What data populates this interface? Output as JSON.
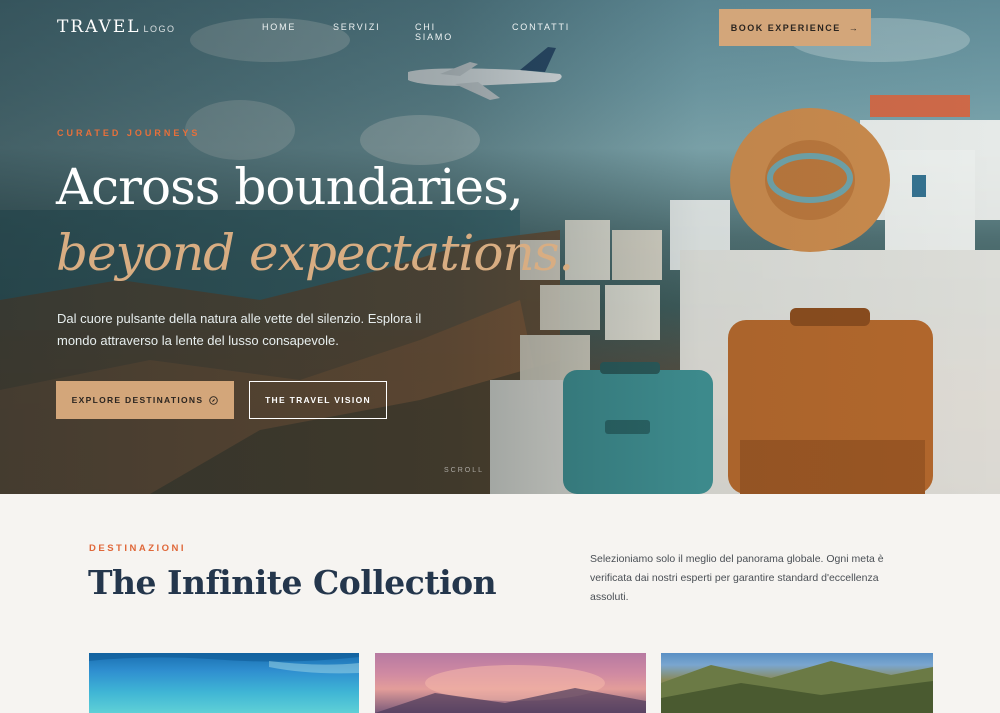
{
  "header": {
    "logo_main": "TRAVEL",
    "logo_sub": "LOGO",
    "nav": [
      "HOME",
      "SERVIZI",
      "CHI SIAMO",
      "CONTATTI"
    ],
    "cta_label": "BOOK EXPERIENCE",
    "cta_icon": "arrow-right-icon"
  },
  "hero": {
    "eyebrow": "CURATED JOURNEYS",
    "title_line1": "Across boundaries,",
    "title_line2": "beyond expectations.",
    "lead": "Dal cuore pulsante della natura alle vette del silenzio. Esplora il mondo attraverso la lente del lusso consapevole.",
    "primary_button": "EXPLORE DESTINATIONS",
    "primary_icon": "compass-icon",
    "secondary_button": "THE TRAVEL VISION",
    "scroll_label": "SCROLL"
  },
  "collection": {
    "eyebrow": "DESTINAZIONI",
    "title": "The Infinite Collection",
    "description": "Selezioniamo solo il meglio del panorama globale. Ogni meta è verificata dai nostri esperti per garantire standard d'eccellenza assoluti."
  },
  "colors": {
    "accent": "#d3a67a",
    "eyebrow": "#e6703b",
    "title": "#24364c",
    "background": "#f6f4f1"
  }
}
